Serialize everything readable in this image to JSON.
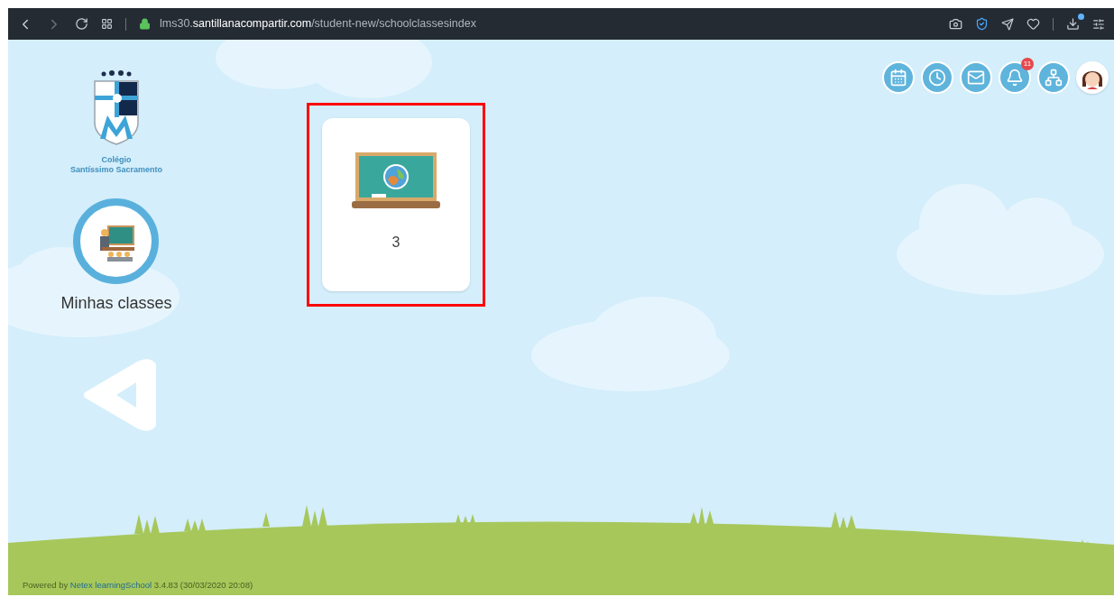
{
  "browser": {
    "url": "lms30.**santillanacompartir.com**/student-new/schoolclassesindex",
    "download_dot": true
  },
  "school": {
    "name_line_1": "Colégio",
    "name_line_2": "Santíssimo Sacramento"
  },
  "nav_items": [
    {
      "label": "Minhas classes",
      "selected": true
    }
  ],
  "header_icons": [
    {
      "kind": "calendar"
    },
    {
      "kind": "clock"
    },
    {
      "kind": "mail"
    },
    {
      "kind": "bell",
      "badge": "11"
    },
    {
      "kind": "network"
    },
    {
      "kind": "avatar"
    }
  ],
  "classes": [
    {
      "label": "3",
      "highlighted": true
    }
  ],
  "footer": {
    "prefix": "Powered by ",
    "link": "Netex learningSchool",
    "suffix": " 3.4.83 (30/03/2020 20:08)"
  }
}
